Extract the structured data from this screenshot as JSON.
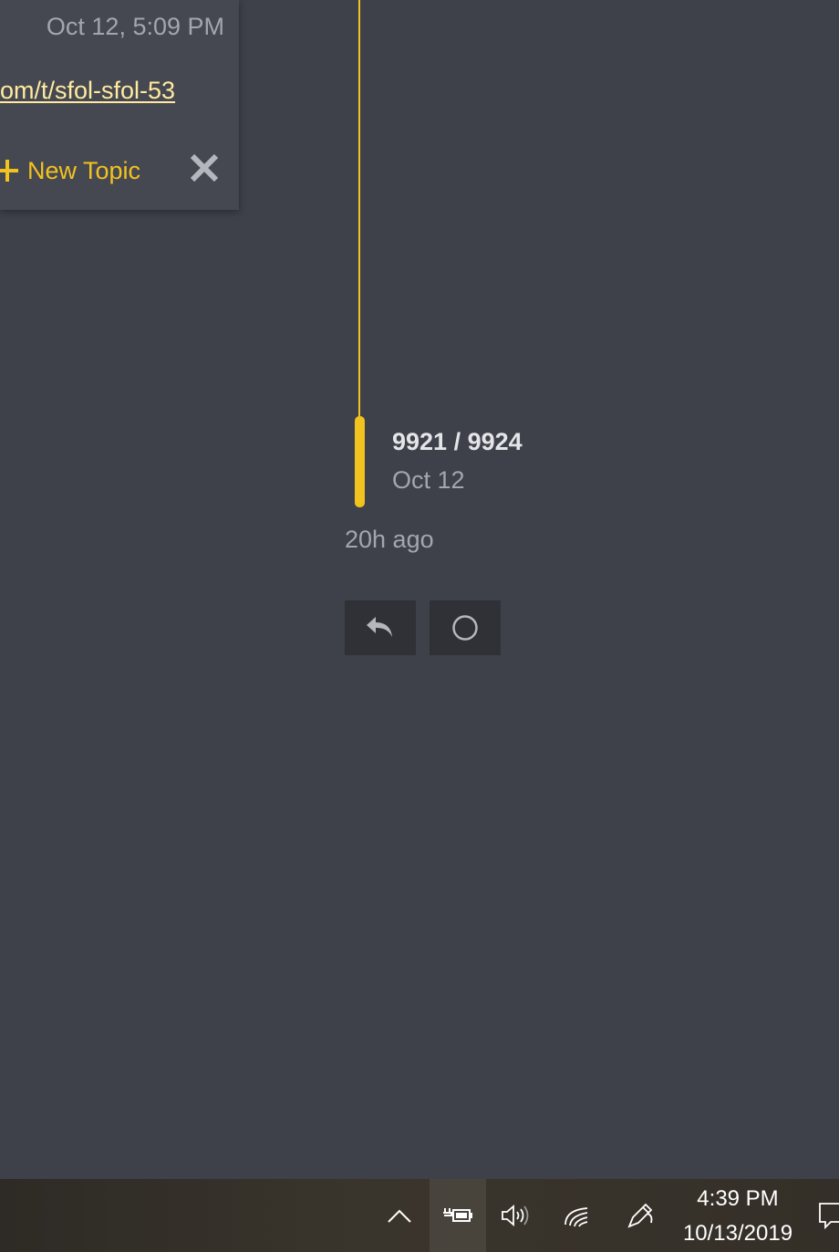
{
  "share_popup": {
    "date": "Oct 12, 5:09 PM",
    "link_text": "om/t/sfol-sfol-53",
    "new_topic_label": "New Topic",
    "icons": {
      "plus": "plus-icon",
      "close": "close-icon"
    }
  },
  "timeline": {
    "progress": "9921 / 9924",
    "date": "Oct 12",
    "last_activity": "20h ago",
    "accent_color": "#f2c21f"
  },
  "actions": {
    "reply_icon": "reply-icon",
    "status_icon": "circle-icon"
  },
  "taskbar": {
    "time": "4:39 PM",
    "date": "10/13/2019",
    "icons": [
      "chevron-up-icon",
      "power-battery-icon",
      "volume-icon",
      "network-icon",
      "pen-icon",
      "notification-icon"
    ]
  }
}
